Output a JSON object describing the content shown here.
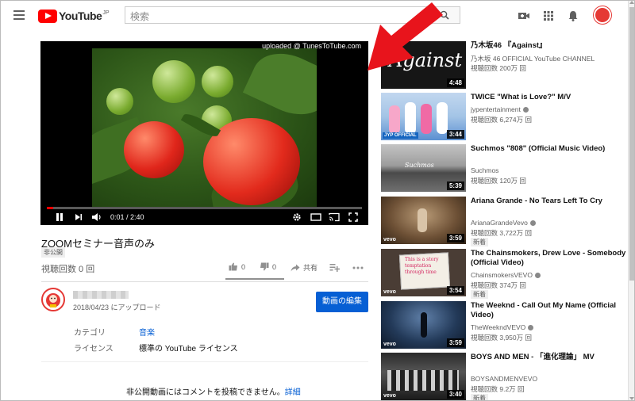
{
  "header": {
    "logo_text": "YouTube",
    "logo_region": "JP",
    "search_placeholder": "検索"
  },
  "player": {
    "overlay_text": "uploaded @ TunesToTube.com",
    "time_current": "0:01",
    "time_total": "2:40",
    "time_display": "0:01 / 2:40",
    "progress": 0.02
  },
  "video": {
    "title": "ZOOMセミナー音声のみ",
    "privacy": "非公開",
    "views": "視聴回数 0 回",
    "likes": "0",
    "dislikes": "0",
    "share_label": "共有",
    "upload_date": "2018/04/23 にアップロード",
    "edit_button": "動画の編集",
    "category_label": "カテゴリ",
    "category_value": "音楽",
    "license_label": "ライセンス",
    "license_value": "標準の YouTube ライセンス"
  },
  "comments": {
    "disabled_text": "非公開動画にはコメントを投稿できません。",
    "details_link": "詳細"
  },
  "recommendations": [
    {
      "title": "乃木坂46 『Against』",
      "channel": "乃木坂 46 OFFICIAL YouTube CHANNEL",
      "verified": false,
      "views": "視聴回数 200万 回",
      "duration": "4:48",
      "thumb_text": "Against",
      "is_new": false
    },
    {
      "title": "TWICE \"What is Love?\" M/V",
      "channel": "jypentertainment",
      "verified": true,
      "views": "視聴回数 6,274万 回",
      "duration": "3:44",
      "thumb_text": "JYP OFFICIAL",
      "is_new": false
    },
    {
      "title": "Suchmos \"808\" (Official Music Video)",
      "channel": "Suchmos",
      "verified": false,
      "views": "視聴回数 120万 回",
      "duration": "5:39",
      "thumb_text": "Suchmos",
      "is_new": false
    },
    {
      "title": "Ariana Grande - No Tears Left To Cry",
      "channel": "ArianaGrandeVevo",
      "verified": true,
      "views": "視聴回数 3,722万 回",
      "duration": "3:59",
      "thumb_text": "vevo",
      "is_new": true
    },
    {
      "title": "The Chainsmokers, Drew Love - Somebody (Official Video)",
      "channel": "ChainsmokersVEVO",
      "verified": true,
      "views": "視聴回数 374万 回",
      "duration": "3:54",
      "thumb_text": "vevo",
      "is_new": true
    },
    {
      "title": "The Weeknd - Call Out My Name (Official Video)",
      "channel": "TheWeekndVEVO",
      "verified": true,
      "views": "視聴回数 3,950万 回",
      "duration": "3:59",
      "thumb_text": "vevo",
      "is_new": false
    },
    {
      "title": "BOYS AND MEN - 「進化理論」 MV",
      "channel": "BOYSANDMENVEVO",
      "verified": false,
      "views": "視聴回数 9.2万 回",
      "duration": "3:40",
      "thumb_text": "vevo",
      "is_new": true
    }
  ],
  "new_badge": "新着",
  "colors": {
    "brand_red": "#ff0000",
    "link_blue": "#065fd4",
    "annotation_arrow": "#e8141c"
  }
}
